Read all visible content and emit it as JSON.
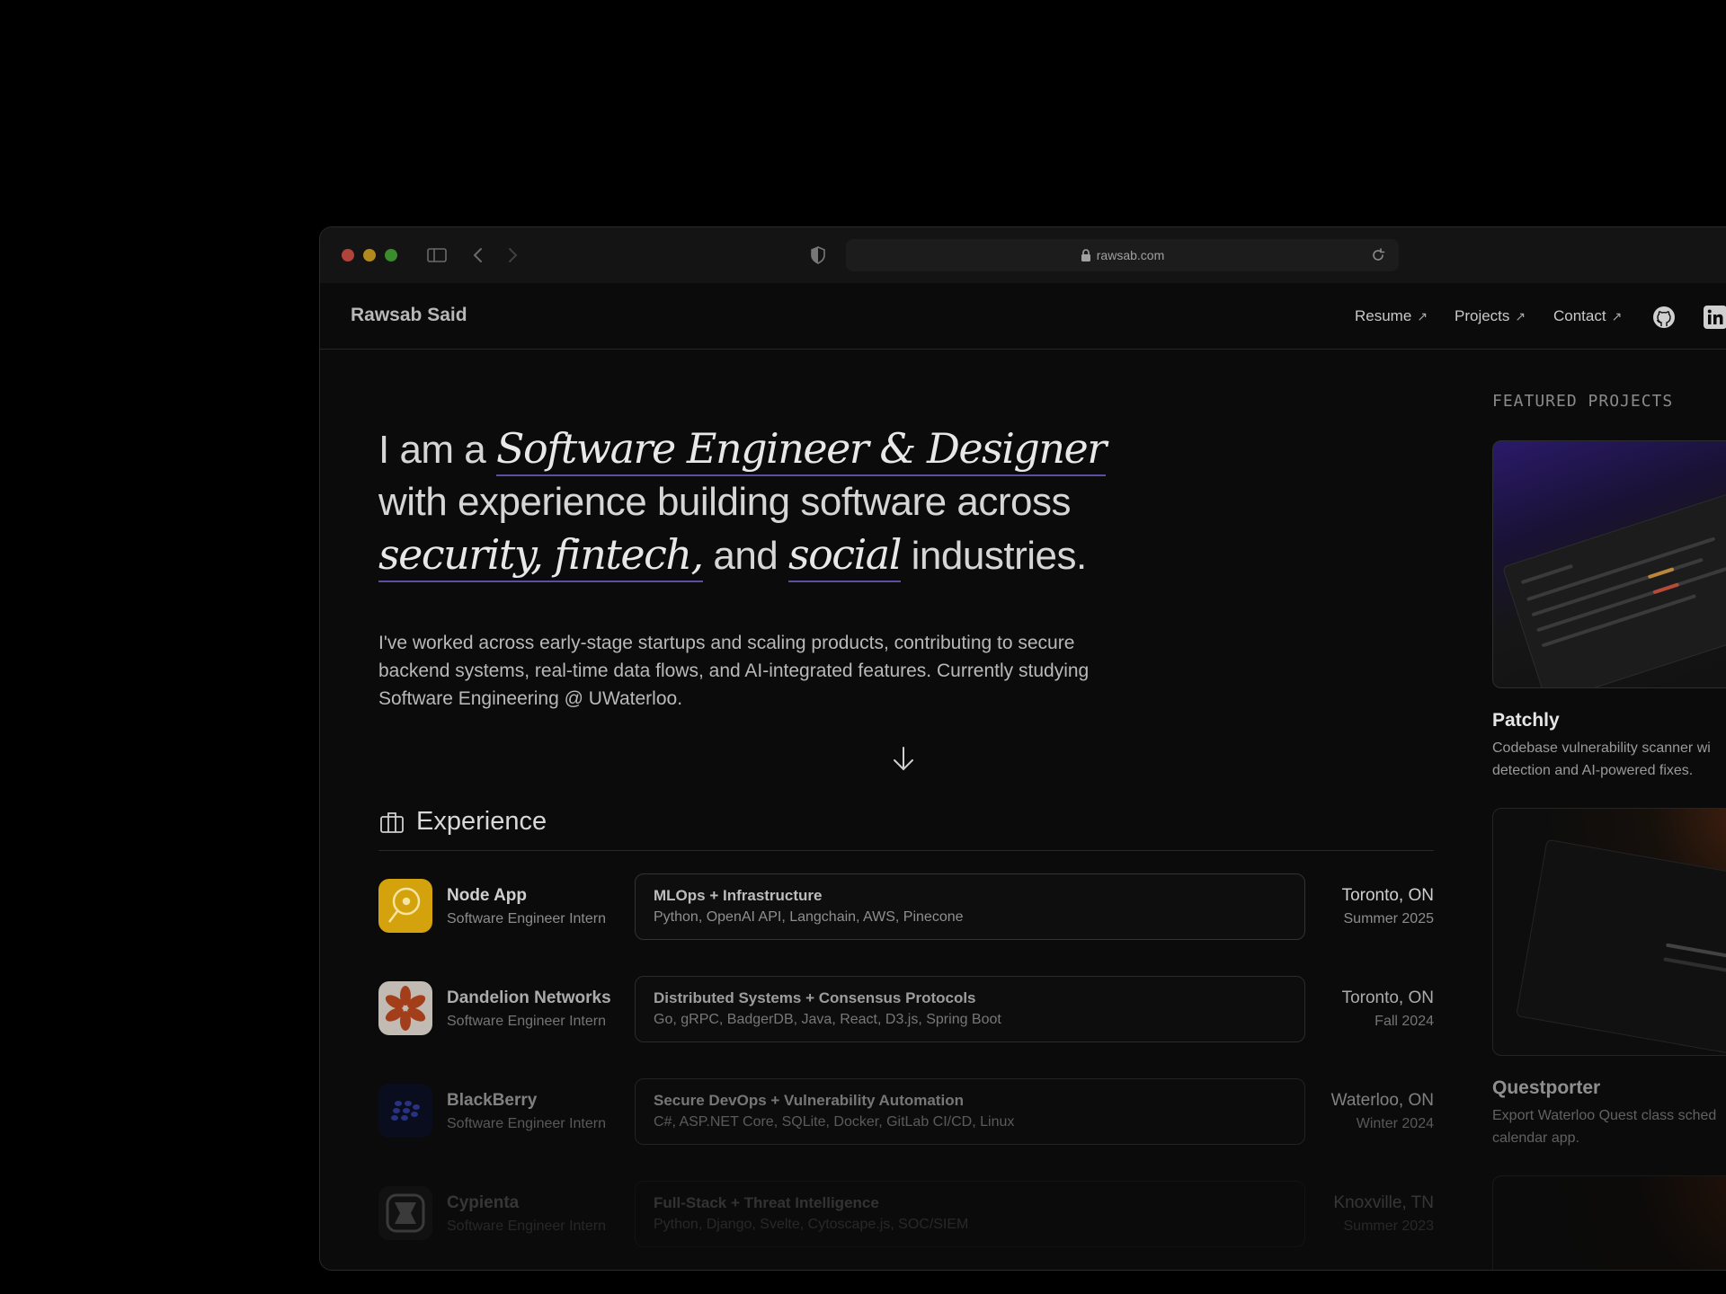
{
  "browser": {
    "url": "rawsab.com"
  },
  "nav": {
    "brand": "Rawsab Said",
    "resume": "Resume",
    "projects": "Projects",
    "contact": "Contact",
    "arrow": "↗"
  },
  "hero": {
    "prefix": "I am a",
    "role": "Software Engineer & Designer",
    "line2": "with experience building software across",
    "industry_1": "security, fintech,",
    "and": "and",
    "industry_2": "social",
    "suffix": "industries.",
    "intro": "I've worked across early-stage startups and scaling products, contributing to secure backend systems, real-time data flows, and AI-integrated features. Currently studying Software Engineering @ UWaterloo."
  },
  "experience": {
    "heading": "Experience",
    "items": [
      {
        "company": "Node App",
        "role": "Software Engineer Intern",
        "focus": "MLOps + Infrastructure",
        "tech": "Python, OpenAI API, Langchain, AWS, Pinecone",
        "location": "Toronto, ON",
        "term": "Summer 2025",
        "logo_color": "#d4a20c"
      },
      {
        "company": "Dandelion Networks",
        "role": "Software Engineer Intern",
        "focus": "Distributed Systems + Consensus Protocols",
        "tech": "Go, gRPC, BadgerDB, Java, React, D3.js, Spring Boot",
        "location": "Toronto, ON",
        "term": "Fall 2024",
        "logo_color": "#c44a1e"
      },
      {
        "company": "BlackBerry",
        "role": "Software Engineer Intern",
        "focus": "Secure DevOps + Vulnerability Automation",
        "tech": "C#, ASP.NET Core, SQLite, Docker, GitLab CI/CD, Linux",
        "location": "Waterloo, ON",
        "term": "Winter 2024",
        "logo_color": "#0a0f2c"
      },
      {
        "company": "Cypienta",
        "role": "Software Engineer Intern",
        "focus": "Full-Stack + Threat Intelligence",
        "tech": "Python, Django, Svelte, Cytoscape.js, SOC/SIEM",
        "location": "Knoxville, TN",
        "term": "Summer 2023",
        "logo_color": "#2a2a2a"
      }
    ]
  },
  "featured": {
    "label": "FEATURED PROJECTS",
    "projects": [
      {
        "title": "Patchly",
        "desc_line1": "Codebase vulnerability scanner wi",
        "desc_line2": "detection and AI-powered fixes."
      },
      {
        "title": "Questporter",
        "desc_line1": "Export Waterloo Quest class sched",
        "desc_line2": "calendar app."
      }
    ]
  },
  "colors": {
    "accent_underline": "#5a4fa0",
    "background": "#0b0b0b"
  }
}
